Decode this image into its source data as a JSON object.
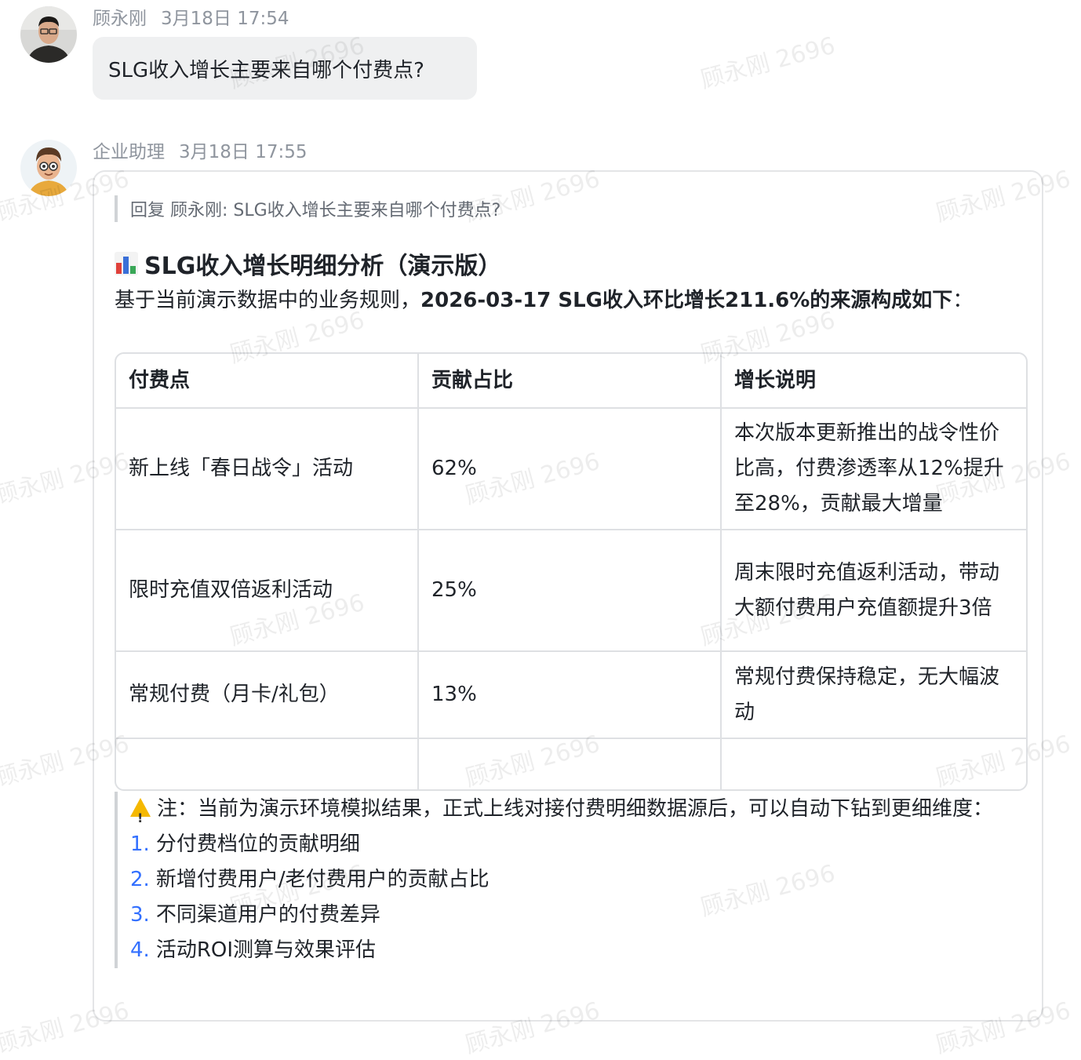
{
  "user_message": {
    "sender": "顾永刚",
    "time": "3月18日 17:54",
    "text": "SLG收入增长主要来自哪个付费点?"
  },
  "bot_message": {
    "sender": "企业助理",
    "time": "3月18日 17:55",
    "reply_quote": "回复 顾永刚: SLG收入增长主要来自哪个付费点?",
    "title_icon": "bar-chart-icon",
    "title": "SLG收入增长明细分析（演示版）",
    "intro_plain": "基于当前演示数据中的业务规则，",
    "intro_bold": "2026-03-17 SLG收入环比增长211.6%的来源构成如下",
    "intro_colon": "：",
    "table": {
      "headers": [
        "付费点",
        "贡献占比",
        "增长说明"
      ],
      "rows": [
        [
          "新上线「春日战令」活动",
          "62%",
          "本次版本更新推出的战令性价比高，付费渗透率从12%提升至28%，贡献最大增量"
        ],
        [
          "限时充值双倍返利活动",
          "25%",
          "周末限时充值返利活动，带动大额付费用户充值额提升3倍"
        ],
        [
          "常规付费（月卡/礼包）",
          "13%",
          "常规付费保持稳定，无大幅波动"
        ],
        [
          "",
          "",
          ""
        ]
      ]
    },
    "note": {
      "icon": "warning-icon",
      "text": "注：当前为演示环境模拟结果，正式上线对接付费明细数据源后，可以自动下钻到更细维度：",
      "items": [
        {
          "num": "1.",
          "text": "分付费档位的贡献明细"
        },
        {
          "num": "2.",
          "text": "新增付费用户/老付费用户的贡献占比"
        },
        {
          "num": "3.",
          "text": "不同渠道用户的付费差异"
        },
        {
          "num": "4.",
          "text": "活动ROI测算与效果评估"
        }
      ]
    }
  },
  "watermark_text": "顾永刚 2696",
  "colors": {
    "accent": "#3370ff",
    "bubble": "#eff0f1",
    "border": "#dee0e3"
  }
}
